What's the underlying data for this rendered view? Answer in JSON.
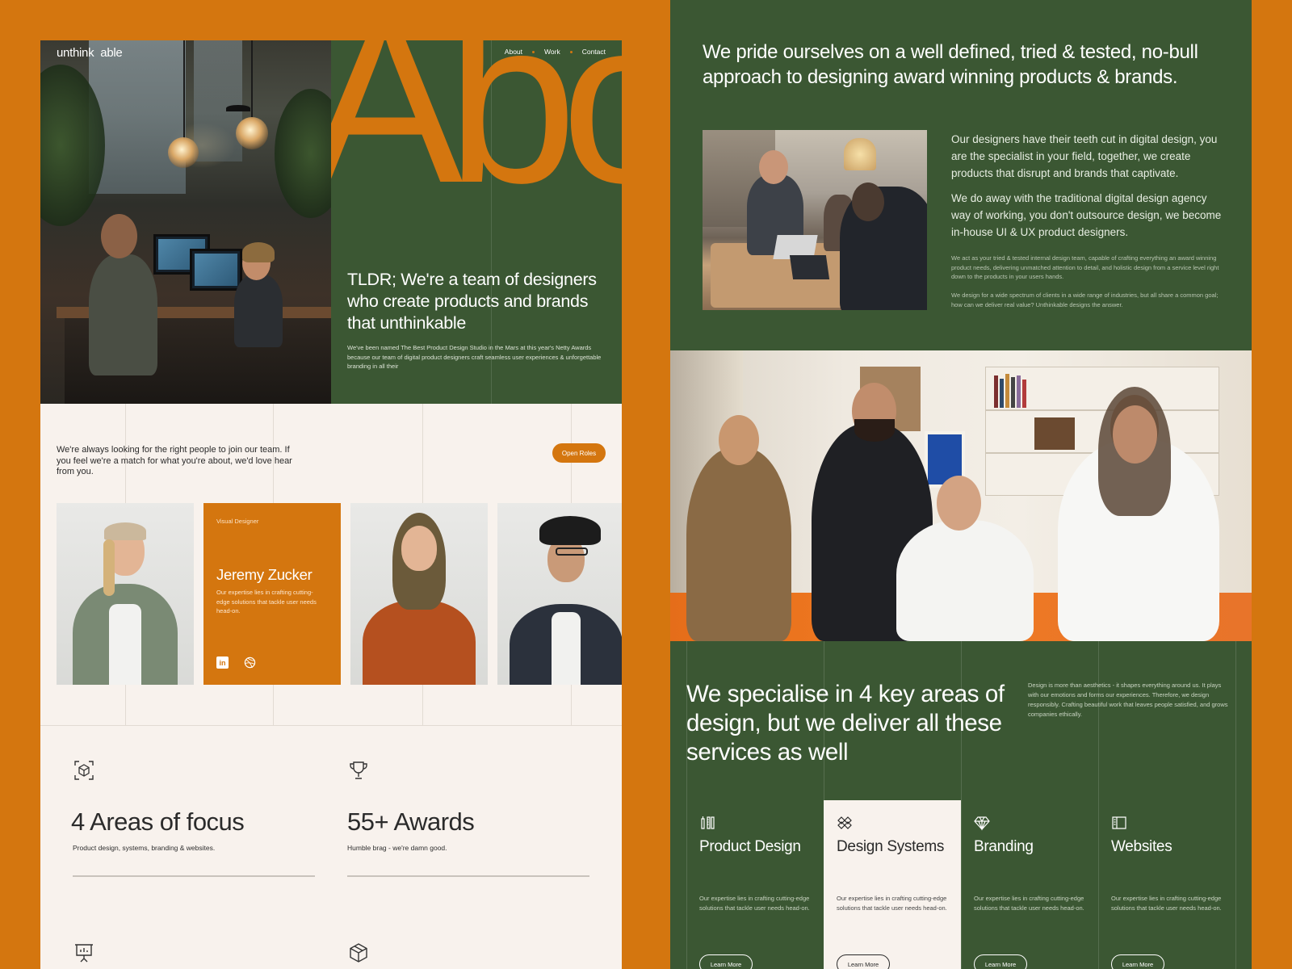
{
  "brand": {
    "logo_left": "unthink",
    "logo_right": "able",
    "accent": "#d4760f",
    "green": "#3b5733",
    "cream": "#f8f2ed"
  },
  "nav": {
    "items": [
      "About",
      "Work",
      "Contact"
    ]
  },
  "hero": {
    "big_word": "Abo",
    "title": "TLDR; We're a team of designers who create products and brands that unthinkable",
    "subtitle": "We've been named The Best Product Design Studio in the Mars at this year's Netty Awards because our team of digital product designers craft seamless user experiences & unforgettable branding in all their"
  },
  "careers": {
    "text": "We're always looking for the right people to join our team. If you feel we're a match for what you're about, we'd love hear from you.",
    "button": "Open Roles"
  },
  "team_card": {
    "role": "Visual Designer",
    "name": "Jeremy Zucker",
    "desc": "Our expertise lies in crafting cutting-edge solutions that tackle user needs head-on.",
    "icons": [
      "linkedin-icon",
      "dribbble-icon"
    ]
  },
  "stats": [
    {
      "icon": "cube-focus-icon",
      "value": "4 Areas of focus",
      "label": "Product design, systems, branding & websites."
    },
    {
      "icon": "trophy-icon",
      "value": "55+ Awards",
      "label": "Humble brag - we're damn good."
    },
    {
      "icon": "presentation-chart-icon"
    },
    {
      "icon": "box-icon"
    }
  ],
  "about": {
    "headline": "We pride ourselves on a well defined, tried & tested, no-bull approach to designing award winning products & brands.",
    "para1": "Our designers have their teeth cut in digital design, you are the specialist in your field, together, we create products that disrupt and brands that captivate.",
    "para2": "We do away with the traditional digital design agency way of working, you don't outsource design, we become in-house UI & UX product designers.",
    "para3": "We act as your tried & tested internal design team, capable of crafting everything an award winning product needs, delivering unmatched attention to detail, and holistic design from a service level right down to the products in your users hands.",
    "para4": "We design for a wide spectrum of clients in a wide range of industries, but all share a common goal; how can we deliver real value? Unthinkable designs the answer."
  },
  "services": {
    "title": "We specialise in 4 key areas of design, but we deliver all these services as well",
    "note": "Design is more than aesthetics - it shapes everything around us. It plays with our emotions and forms our experiences. Therefore, we design responsibly. Crafting beautiful work that leaves people satisfied, and grows companies ethically.",
    "items": [
      {
        "icon": "pencil-ruler-icon",
        "title": "Product Design",
        "desc": "Our expertise lies in crafting cutting-edge solutions that tackle user needs head-on.",
        "button": "Learn More"
      },
      {
        "icon": "stack-layers-icon",
        "title": "Design Systems",
        "desc": "Our expertise lies in crafting cutting-edge solutions that tackle user needs head-on.",
        "button": "Learn More"
      },
      {
        "icon": "diamond-icon",
        "title": "Branding",
        "desc": "Our expertise lies in crafting cutting-edge solutions that tackle user needs head-on.",
        "button": "Learn More"
      },
      {
        "icon": "browser-icon",
        "title": "Websites",
        "desc": "Our expertise lies in crafting cutting-edge solutions that tackle user needs head-on.",
        "button": "Learn More"
      }
    ]
  }
}
